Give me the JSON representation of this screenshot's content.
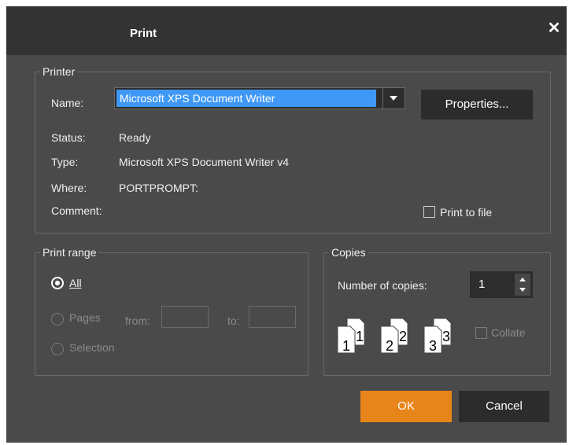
{
  "dialog": {
    "title": "Print",
    "close_label": "✕"
  },
  "printer": {
    "group_label": "Printer",
    "name_label": "Name:",
    "name_value": "Microsoft XPS Document Writer",
    "properties_button": "Properties...",
    "status_label": "Status:",
    "status_value": "Ready",
    "type_label": "Type:",
    "type_value": "Microsoft XPS Document Writer v4",
    "where_label": "Where:",
    "where_value": "PORTPROMPT:",
    "comment_label": "Comment:",
    "print_to_file_label": "Print to file",
    "print_to_file_checked": false
  },
  "print_range": {
    "group_label": "Print range",
    "all_label": "All",
    "pages_label": "Pages",
    "from_label": "from:",
    "to_label": "to:",
    "from_value": "",
    "to_value": "",
    "selection_label": "Selection",
    "selected": "All"
  },
  "copies": {
    "group_label": "Copies",
    "number_label": "Number of copies:",
    "number_value": "1",
    "collate_label": "Collate",
    "collate_checked": false,
    "collate_icon_numbers": [
      "1",
      "2",
      "3"
    ]
  },
  "buttons": {
    "ok": "OK",
    "cancel": "Cancel"
  },
  "colors": {
    "dialog_bg": "#4a4a4a",
    "titlebar_bg": "#333333",
    "selection_blue": "#3f98f5",
    "ok_orange": "#e8851a",
    "button_dark": "#2c2c2c"
  }
}
